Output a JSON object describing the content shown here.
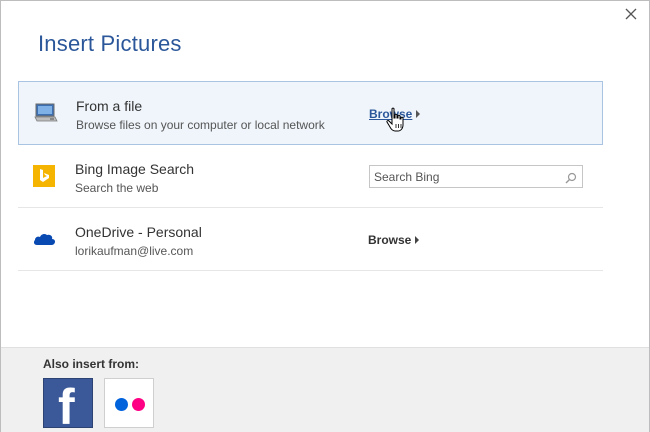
{
  "dialog": {
    "title": "Insert Pictures",
    "close_icon": "close-icon"
  },
  "options": [
    {
      "icon": "computer-icon",
      "title": "From a file",
      "subtitle": "Browse files on your computer or local network",
      "action_label": "Browse",
      "selected": true
    },
    {
      "icon": "bing-icon",
      "title": "Bing Image Search",
      "subtitle": "Search the web",
      "search_placeholder": "Search Bing",
      "search_value": ""
    },
    {
      "icon": "onedrive-icon",
      "title": "OneDrive - Personal",
      "subtitle": "lorikaufman@live.com",
      "action_label": "Browse"
    }
  ],
  "footer": {
    "label": "Also insert from:",
    "services": [
      {
        "icon": "facebook-icon",
        "glyph": "f"
      },
      {
        "icon": "flickr-icon"
      }
    ]
  },
  "colors": {
    "title_blue": "#2b579a",
    "selected_bg": "#eff5fb",
    "selected_border": "#a9c4e2",
    "bing_yellow": "#f4b400",
    "onedrive_blue": "#094ab2",
    "facebook_blue": "#3b5998",
    "flickr_blue": "#0063dc",
    "flickr_pink": "#ff0084"
  }
}
